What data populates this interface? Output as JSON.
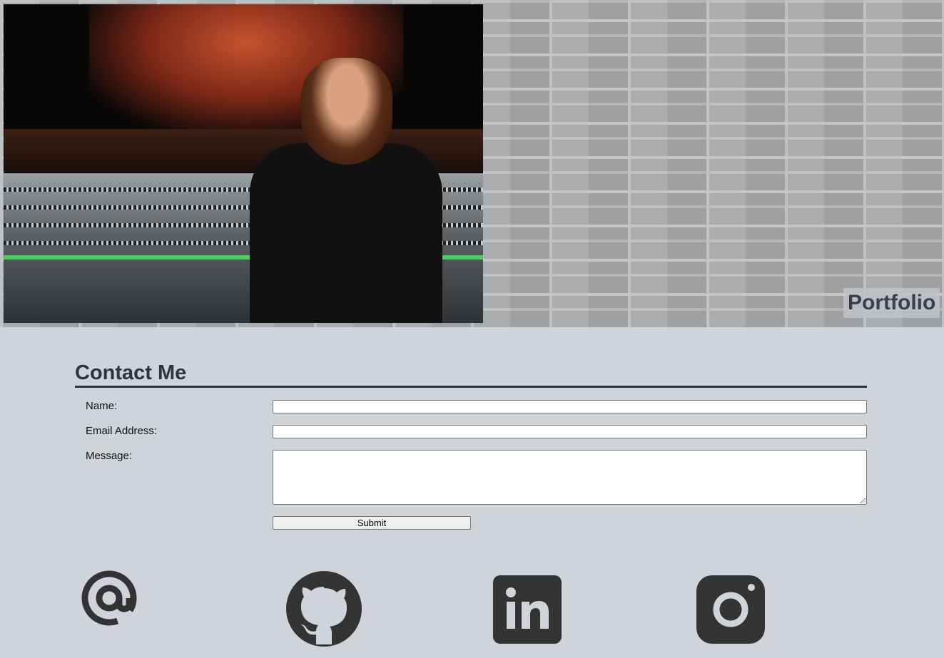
{
  "hero": {
    "portfolio_label": "Portfolio"
  },
  "contact": {
    "title": "Contact Me",
    "name_label": "Name:",
    "name_value": "",
    "email_label": "Email Address:",
    "email_value": "",
    "message_label": "Message:",
    "message_value": "",
    "submit_label": "Submit"
  },
  "social": {
    "items": [
      {
        "icon": "at-sign-icon"
      },
      {
        "icon": "github-icon"
      },
      {
        "icon": "linkedin-icon"
      },
      {
        "icon": "instagram-icon"
      }
    ],
    "icon_color": "#333333"
  },
  "colors": {
    "page_background": "#cfd3da",
    "heading": "#2f333b"
  }
}
